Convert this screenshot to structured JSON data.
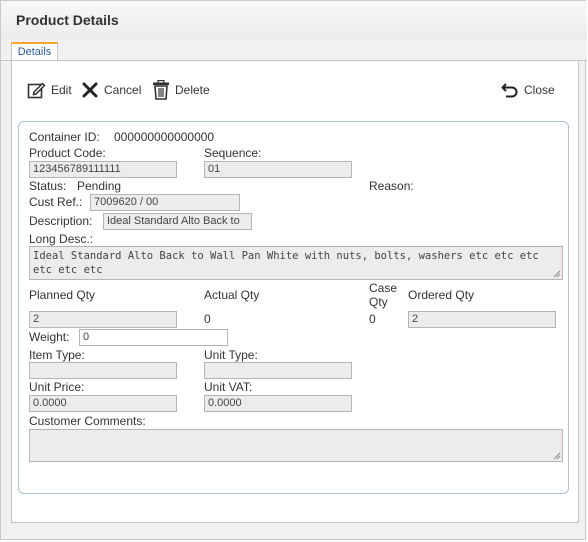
{
  "window": {
    "title": "Product Details"
  },
  "tabs": [
    {
      "label": "Details",
      "active": true
    }
  ],
  "toolbar": {
    "edit_label": "Edit",
    "cancel_label": "Cancel",
    "delete_label": "Delete",
    "close_label": "Close"
  },
  "details": {
    "container_id_label": "Container ID:",
    "container_id_value": "000000000000000",
    "product_code_label": "Product Code:",
    "product_code_value": "123456789111111",
    "sequence_label": "Sequence:",
    "sequence_value": "01",
    "status_label": "Status:",
    "status_value": "Pending",
    "reason_label": "Reason:",
    "cust_ref_label": "Cust Ref.:",
    "cust_ref_value": "7009620 / 00",
    "description_label": "Description:",
    "description_value": "Ideal Standard Alto Back to",
    "long_desc_label": "Long Desc.:",
    "long_desc_value": "Ideal Standard Alto Back to Wall Pan White with nuts, bolts, washers etc etc etc etc etc etc",
    "planned_qty_label": "Planned Qty",
    "planned_qty_value": "2",
    "actual_qty_label": "Actual Qty",
    "actual_qty_value": "0",
    "case_qty_label_line1": "Case",
    "case_qty_label_line2": "Qty",
    "case_qty_value": "0",
    "ordered_qty_label": "Ordered Qty",
    "ordered_qty_value": "2",
    "weight_label": "Weight:",
    "weight_value": "0",
    "item_type_label": "Item Type:",
    "item_type_value": "",
    "unit_type_label": "Unit Type:",
    "unit_type_value": "",
    "unit_price_label": "Unit Price:",
    "unit_price_value": "0.0000",
    "unit_vat_label": "Unit VAT:",
    "unit_vat_value": "0.0000",
    "customer_comments_label": "Customer Comments:",
    "customer_comments_value": ""
  },
  "colors": {
    "tab_accent": "#f0a830",
    "tab_text": "#2a5d9a",
    "box_border": "#a9c1d6",
    "field_bg": "#ececec"
  },
  "icons": [
    "edit-icon",
    "cancel-icon",
    "delete-icon",
    "close-icon"
  ]
}
